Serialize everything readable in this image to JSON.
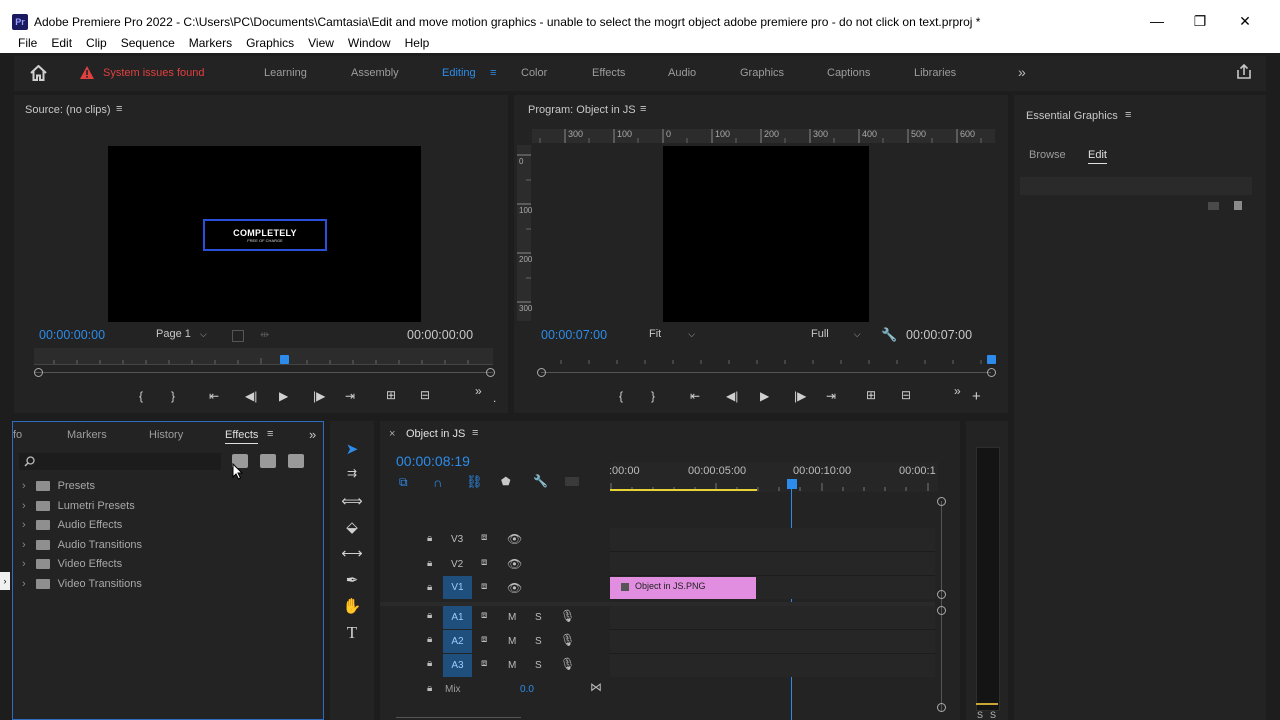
{
  "window": {
    "app_icon": "Pr",
    "title": "Adobe Premiere Pro 2022 - C:\\Users\\PC\\Documents\\Camtasia\\Edit and move motion graphics - unable to select the mogrt object adobe premiere pro - do not click on text.prproj *",
    "minimize": "—",
    "restore": "❐",
    "close": "✕"
  },
  "menu": [
    "File",
    "Edit",
    "Clip",
    "Sequence",
    "Markers",
    "Graphics",
    "View",
    "Window",
    "Help"
  ],
  "workspace": {
    "warning": "System issues found",
    "tabs": [
      "Learning",
      "Assembly",
      "Editing",
      "Color",
      "Effects",
      "Audio",
      "Graphics",
      "Captions",
      "Libraries"
    ],
    "active_tab": "Editing",
    "more": "»"
  },
  "source": {
    "title": "Source: (no clips)",
    "in_timecode": "00:00:00:00",
    "page": "Page 1",
    "out_timecode": "00:00:00:00",
    "graphic_main": "COMPLETELY",
    "graphic_sub": "FREE OF CHARGE"
  },
  "program": {
    "title": "Program: Object in JS",
    "timecode": "00:00:07:00",
    "fit": "Fit",
    "quality": "Full",
    "duration": "00:00:07:00",
    "ruler_top": [
      "300",
      "100",
      "0",
      "100",
      "200",
      "300",
      "400",
      "500",
      "600"
    ],
    "ruler_left": [
      "0",
      "100",
      "200",
      "300"
    ]
  },
  "essential_graphics": {
    "title": "Essential Graphics",
    "tabs": [
      "Browse",
      "Edit"
    ],
    "active_tab": "Edit"
  },
  "effects_panel": {
    "tabs": [
      "fo",
      "Markers",
      "History",
      "Effects"
    ],
    "active_tab": "Effects",
    "items": [
      "Presets",
      "Lumetri Presets",
      "Audio Effects",
      "Audio Transitions",
      "Video Effects",
      "Video Transitions"
    ]
  },
  "timeline": {
    "tab_title": "Object in JS",
    "timecode": "00:00:08:19",
    "ruler": [
      ":00:00",
      "00:00:05:00",
      "00:00:10:00",
      "00:00:1"
    ],
    "video_tracks": [
      "V3",
      "V2",
      "V1"
    ],
    "audio_tracks": [
      "A1",
      "A2",
      "A3"
    ],
    "mute": "M",
    "solo": "S",
    "mix_label": "Mix",
    "mix_value": "0.0",
    "clip": "Object in JS.PNG",
    "meter_labels": [
      "S",
      "S"
    ]
  },
  "colors": {
    "accent": "#2d8ceb",
    "warning": "#e04040",
    "clip": "#e28ee0",
    "panel": "#232323",
    "background": "#1d1d1d"
  }
}
